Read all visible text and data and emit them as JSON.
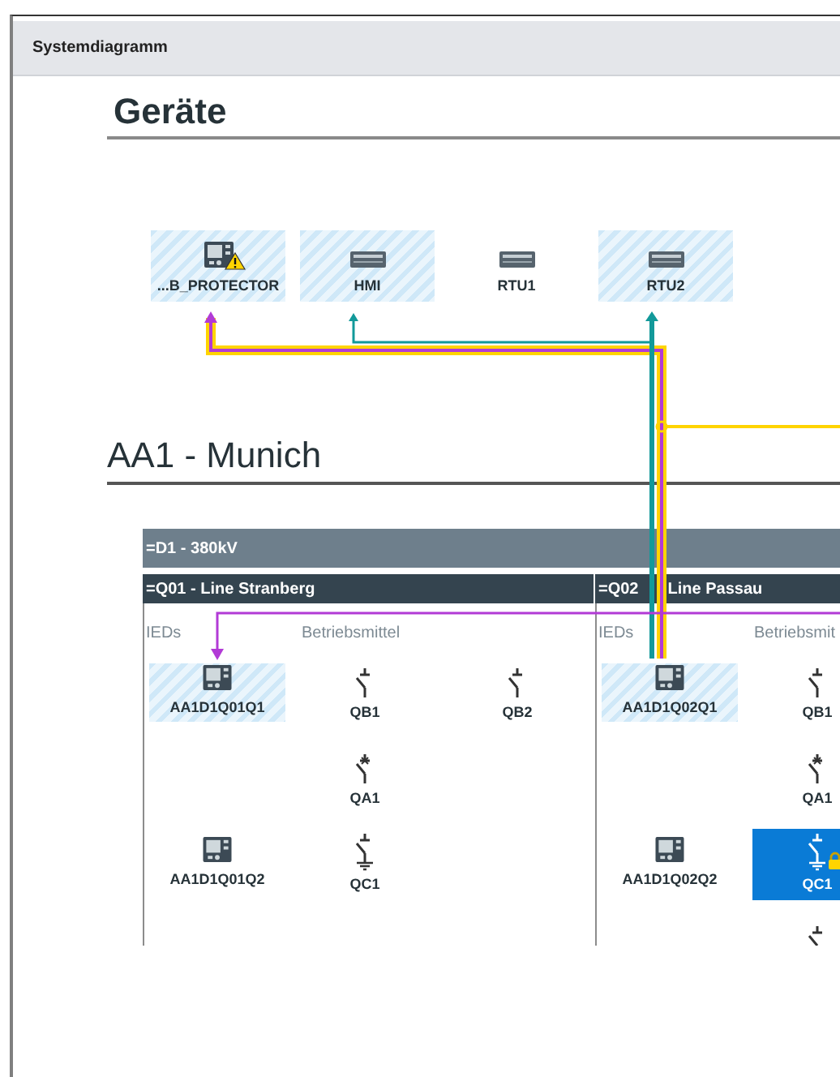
{
  "window": {
    "title": "Systemdiagramm"
  },
  "devices": {
    "heading": "Geräte",
    "items": [
      {
        "label": "...B_PROTECTOR",
        "kind": "ied",
        "selected": true,
        "warning": true
      },
      {
        "label": "HMI",
        "kind": "rack",
        "selected": true,
        "warning": false
      },
      {
        "label": "RTU1",
        "kind": "rack",
        "selected": false,
        "warning": false
      },
      {
        "label": "RTU2",
        "kind": "rack",
        "selected": true,
        "warning": false
      }
    ]
  },
  "substation": {
    "heading": "AA1 - Munich",
    "voltage_level": "=D1 - 380kV",
    "bays": [
      {
        "title": "=Q01 - Line Stranberg",
        "ieds_label": "IEDs",
        "equipment_label": "Betriebsmittel",
        "ieds": [
          {
            "label": "AA1D1Q01Q1",
            "selected": true
          },
          {
            "label": "AA1D1Q01Q2",
            "selected": false
          }
        ],
        "equipment_rows": [
          [
            {
              "label": "QB1",
              "kind": "disconnector",
              "selected": false,
              "locked": false
            },
            {
              "label": "QB2",
              "kind": "disconnector",
              "selected": false,
              "locked": false
            }
          ],
          [
            {
              "label": "QA1",
              "kind": "breaker",
              "selected": false,
              "locked": false
            }
          ],
          [
            {
              "label": "QC1",
              "kind": "earthing",
              "selected": false,
              "locked": false
            }
          ]
        ]
      },
      {
        "title": "=Q02",
        "subtitle": "Line Passau",
        "ieds_label": "IEDs",
        "equipment_label": "Betriebsmit",
        "ieds": [
          {
            "label": "AA1D1Q02Q1",
            "selected": true
          },
          {
            "label": "AA1D1Q02Q2",
            "selected": false
          }
        ],
        "equipment_rows": [
          [
            {
              "label": "QB1",
              "kind": "disconnector",
              "selected": false,
              "locked": false
            }
          ],
          [
            {
              "label": "QA1",
              "kind": "breaker",
              "selected": false,
              "locked": false
            }
          ],
          [
            {
              "label": "QC1",
              "kind": "earthing",
              "selected": true,
              "locked": true
            }
          ],
          [
            {
              "kind": "disconnector",
              "selected": false,
              "locked": false
            }
          ]
        ]
      }
    ]
  }
}
